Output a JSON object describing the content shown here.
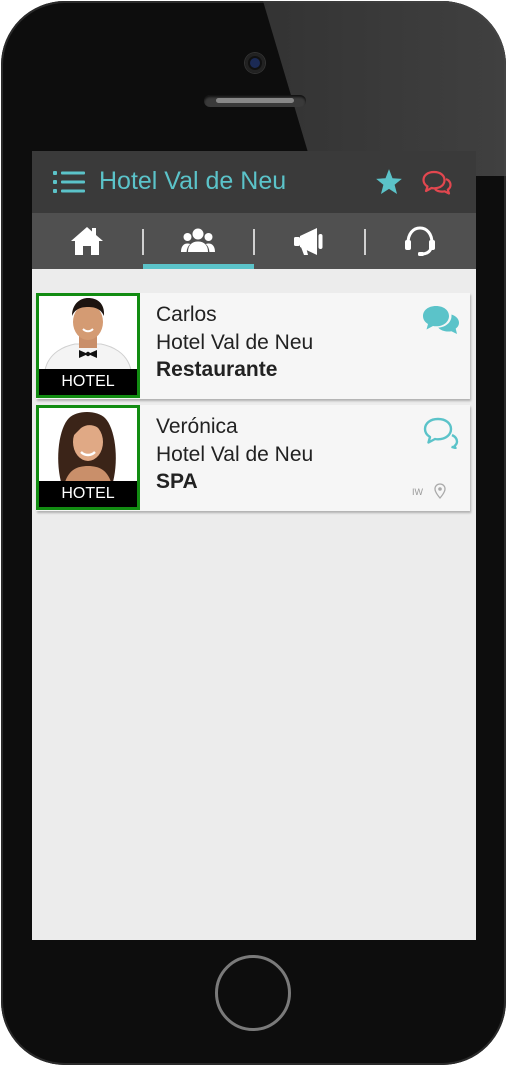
{
  "header": {
    "title": "Hotel Val de Neu",
    "icons": {
      "menu": "menu-list-icon",
      "favorites": "star-icon",
      "chat": "chat-bubbles-icon"
    },
    "colors": {
      "accent": "#5bc3c9",
      "chat_alert": "#e2474f",
      "bar": "#3a3a3a"
    }
  },
  "tabs": [
    {
      "icon": "home-icon",
      "active": false
    },
    {
      "icon": "users-icon",
      "active": true
    },
    {
      "icon": "megaphone-icon",
      "active": false
    },
    {
      "icon": "headset-icon",
      "active": false
    }
  ],
  "contacts": [
    {
      "name": "Carlos",
      "hotel": "Hotel Val de Neu",
      "department": "Restaurante",
      "tag": "HOTEL",
      "extra": ""
    },
    {
      "name": "Verónica",
      "hotel": "Hotel Val de Neu",
      "department": "SPA",
      "tag": "HOTEL",
      "extra": "IW"
    }
  ]
}
